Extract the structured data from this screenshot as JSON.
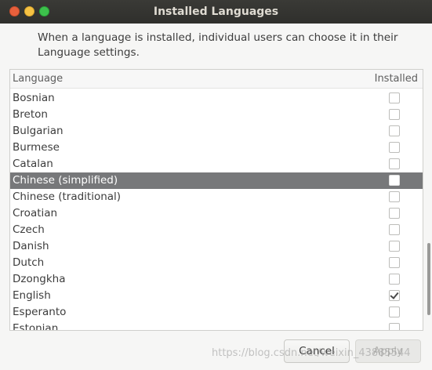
{
  "window": {
    "title": "Installed Languages"
  },
  "description": "When a language is installed, individual users can choose it in their Language settings.",
  "list": {
    "header_language": "Language",
    "header_installed": "Installed",
    "items": [
      {
        "label": "Bosnian",
        "installed": false,
        "selected": false
      },
      {
        "label": "Breton",
        "installed": false,
        "selected": false
      },
      {
        "label": "Bulgarian",
        "installed": false,
        "selected": false
      },
      {
        "label": "Burmese",
        "installed": false,
        "selected": false
      },
      {
        "label": "Catalan",
        "installed": false,
        "selected": false
      },
      {
        "label": "Chinese (simplified)",
        "installed": false,
        "selected": true
      },
      {
        "label": "Chinese (traditional)",
        "installed": false,
        "selected": false
      },
      {
        "label": "Croatian",
        "installed": false,
        "selected": false
      },
      {
        "label": "Czech",
        "installed": false,
        "selected": false
      },
      {
        "label": "Danish",
        "installed": false,
        "selected": false
      },
      {
        "label": "Dutch",
        "installed": false,
        "selected": false
      },
      {
        "label": "Dzongkha",
        "installed": false,
        "selected": false
      },
      {
        "label": "English",
        "installed": true,
        "selected": false
      },
      {
        "label": "Esperanto",
        "installed": false,
        "selected": false
      },
      {
        "label": "Estonian",
        "installed": false,
        "selected": false
      }
    ]
  },
  "buttons": {
    "cancel_label": "Cancel",
    "apply_label": "Apply"
  },
  "watermark": "https://blog.csdn.net/weixin_43885544"
}
